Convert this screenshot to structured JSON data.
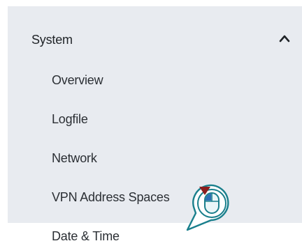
{
  "sidebar": {
    "section": {
      "title": "System",
      "icon": "chevron-up-icon"
    },
    "items": [
      {
        "label": "Overview"
      },
      {
        "label": "Logfile"
      },
      {
        "label": "Network"
      },
      {
        "label": "VPN Address Spaces"
      },
      {
        "label": "Date & Time"
      }
    ]
  },
  "colors": {
    "panel_background": "#e8ebf0",
    "text": "#2b2f34",
    "cursor_bubble": "#1a7f8c",
    "cursor_indicator": "#8b1e1e"
  },
  "cursor": {
    "icon": "mouse-click-icon"
  }
}
